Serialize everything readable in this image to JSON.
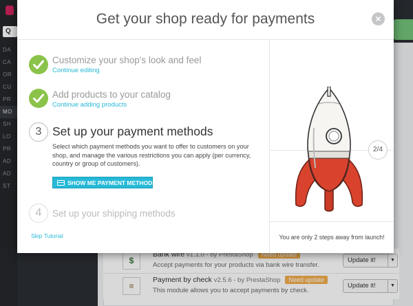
{
  "modal": {
    "title": "Get your shop ready for payments",
    "close_symbol": "×",
    "steps": [
      {
        "status": "done",
        "title": "Customize your shop's look and feel",
        "link": "Continue editing"
      },
      {
        "status": "done",
        "title": "Add products to your catalog",
        "link": "Continue adding products"
      },
      {
        "status": "current",
        "number": "3",
        "title": "Set up your payment methods",
        "description": "Select which payment methods you want to offer to customers on your shop, and manage the various restrictions you can apply (per currency, country or group of customers).",
        "button": "SHOW ME PAYMENT METHODS"
      },
      {
        "status": "upcoming",
        "number": "4",
        "title": "Set up your shipping methods"
      }
    ],
    "skip_link": "Skip Tutorial",
    "progress": "2/4",
    "footer": "You are only 2 steps away from launch!"
  },
  "background": {
    "search_icon_label": "Q",
    "nav": [
      "DA",
      "CA",
      "OR",
      "CU",
      "PR",
      "MO",
      "SH",
      "LO",
      "PR",
      "AD",
      "AD",
      "ST"
    ],
    "modules": [
      {
        "icon": "$",
        "icon_color": "#3c763d",
        "title": "Bank wire",
        "meta": "v1.1.0 - by PrestaShop",
        "badge": "Need update",
        "description": "Accept payments for your products via bank wire transfer.",
        "update_label": "Update it!"
      },
      {
        "icon": "≡",
        "icon_color": "#8a6d3b",
        "title": "Payment by check",
        "meta": "v2.5.6 - by PrestaShop",
        "badge": "Need update",
        "description": "This module allows you to accept payments by check.",
        "update_label": "Update it!"
      }
    ]
  },
  "colors": {
    "accent": "#25b9d7",
    "done": "#8bc34a",
    "rocket_red": "#d9432e"
  }
}
